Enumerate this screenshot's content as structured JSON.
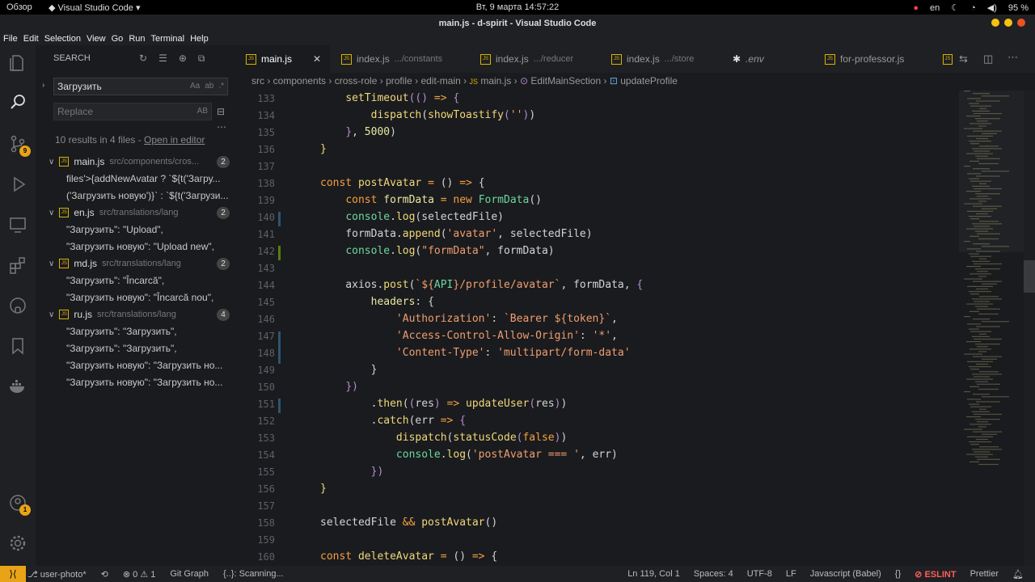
{
  "os": {
    "activities": "Обзор",
    "app": "Visual Studio Code",
    "clock": "Вт, 9 марта  14:57:22",
    "lang": "en",
    "battery": "95 %"
  },
  "window": {
    "title": "main.js - d-spirit - Visual Studio Code"
  },
  "menu": [
    "File",
    "Edit",
    "Selection",
    "View",
    "Go",
    "Run",
    "Terminal",
    "Help"
  ],
  "activity": {
    "scm_badge": "9",
    "accounts_badge": "1"
  },
  "search": {
    "header": "SEARCH",
    "query": "Загрузить",
    "replace_placeholder": "Replace",
    "results_text": "10 results in 4 files - ",
    "open_in_editor": "Open in editor",
    "files": [
      {
        "name": "main.js",
        "path": "src/components/cros...",
        "count": "2",
        "lines": [
          "files'>{addNewAvatar ? `${t('Загру...",
          "('Загрузить новую')}` : `${t('Загрузи..."
        ]
      },
      {
        "name": "en.js",
        "path": "src/translations/lang",
        "count": "2",
        "lines": [
          "\"Загрузить\": \"Upload\",",
          "\"Загрузить новую\": \"Upload new\","
        ]
      },
      {
        "name": "md.js",
        "path": "src/translations/lang",
        "count": "2",
        "lines": [
          "\"Загрузить\": \"Încarcă\",",
          "\"Загрузить новую\": \"Încarcă nou\","
        ]
      },
      {
        "name": "ru.js",
        "path": "src/translations/lang",
        "count": "4",
        "lines": [
          "\"Загрузить\": \"Загрузить\",",
          "\"Загрузить\": \"Загрузить\",",
          "\"Загрузить новую\": \"Загрузить но...",
          "\"Загрузить новую\": \"Загрузить но..."
        ]
      }
    ]
  },
  "tabs": [
    {
      "name": "main.js",
      "sub": "",
      "active": true
    },
    {
      "name": "index.js",
      "sub": ".../constants"
    },
    {
      "name": "index.js",
      "sub": ".../reducer"
    },
    {
      "name": "index.js",
      "sub": ".../store"
    },
    {
      "name": ".env",
      "sub": ""
    },
    {
      "name": "for-professor.js",
      "sub": ""
    }
  ],
  "breadcrumb": [
    "src",
    "components",
    "cross-role",
    "profile",
    "edit-main",
    "main.js",
    "EditMainSection",
    "updateProfile"
  ],
  "editor": {
    "line_numbers": [
      "133",
      "134",
      "135",
      "136",
      "137",
      "138",
      "139",
      "140",
      "141",
      "142",
      "143",
      "144",
      "145",
      "146",
      "147",
      "148",
      "149",
      "150",
      "151",
      "152",
      "153",
      "154",
      "155",
      "156",
      "157",
      "158",
      "159",
      "160"
    ]
  },
  "status": {
    "branch": "user-photo*",
    "problems": "⊗ 0 ⚠ 1",
    "gitgraph": "Git Graph",
    "scanning": "{..}: Scanning...",
    "position": "Ln 119, Col 1",
    "spaces": "Spaces: 4",
    "encoding": "UTF-8",
    "eol": "LF",
    "language": "Javascript (Babel)",
    "eslint": "ESLINT",
    "prettier": "Prettier"
  },
  "colors": {
    "accent": "#e8a317",
    "background": "#1a1b1e",
    "keyword": "#f6a040",
    "function": "#f0d879",
    "string": "#ef9e6f"
  }
}
